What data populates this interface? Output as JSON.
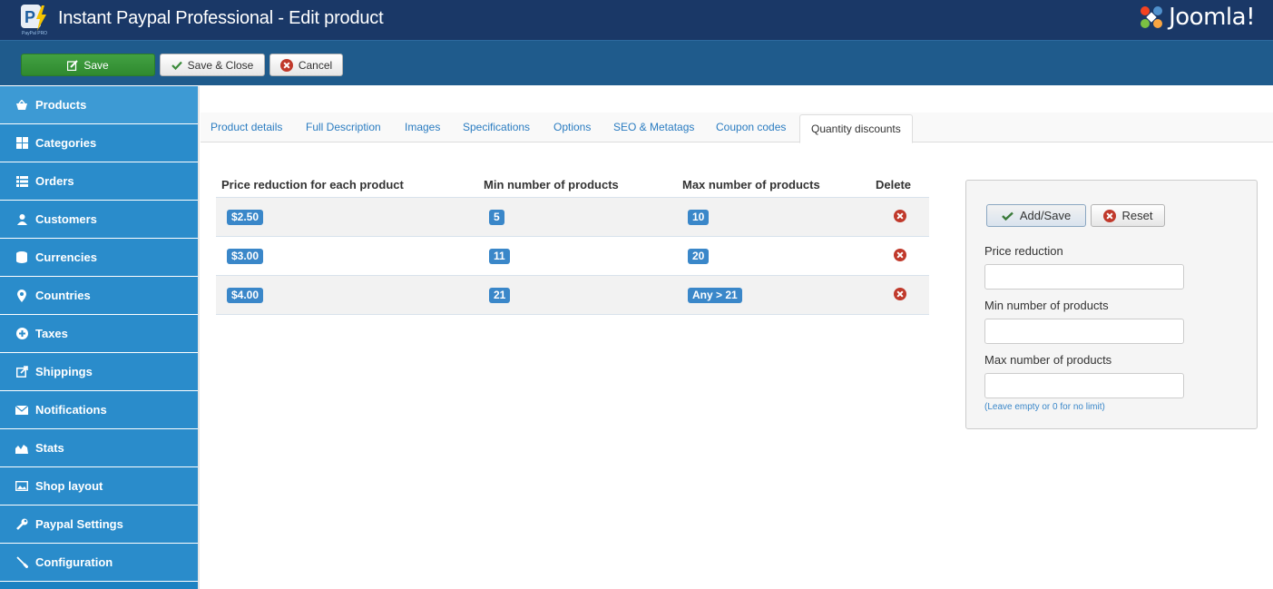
{
  "header": {
    "title": "Instant Paypal Professional - Edit product",
    "brand": "Joomla!",
    "app_logo_text": "PayPal PRO"
  },
  "toolbar": {
    "save_label": "Save",
    "save_close_label": "Save & Close",
    "cancel_label": "Cancel"
  },
  "sidebar": {
    "items": [
      {
        "label": "Products",
        "icon": "basket-icon"
      },
      {
        "label": "Categories",
        "icon": "grid-icon"
      },
      {
        "label": "Orders",
        "icon": "list-icon"
      },
      {
        "label": "Customers",
        "icon": "user-icon"
      },
      {
        "label": "Currencies",
        "icon": "database-icon"
      },
      {
        "label": "Countries",
        "icon": "location-pin-icon"
      },
      {
        "label": "Taxes",
        "icon": "plus-circle-icon"
      },
      {
        "label": "Shippings",
        "icon": "external-link-icon"
      },
      {
        "label": "Notifications",
        "icon": "envelope-icon"
      },
      {
        "label": "Stats",
        "icon": "chart-icon"
      },
      {
        "label": "Shop layout",
        "icon": "image-icon"
      },
      {
        "label": "Paypal Settings",
        "icon": "wrench-icon"
      },
      {
        "label": "Configuration",
        "icon": "screwdriver-icon"
      }
    ]
  },
  "tabs": [
    {
      "label": "Product details"
    },
    {
      "label": "Full Description"
    },
    {
      "label": "Images"
    },
    {
      "label": "Specifications"
    },
    {
      "label": "Options"
    },
    {
      "label": "SEO & Metatags"
    },
    {
      "label": "Coupon codes"
    },
    {
      "label": "Quantity discounts"
    }
  ],
  "discounts_table": {
    "headers": [
      "Price reduction for each product",
      "Min number of products",
      "Max number of products",
      "Delete"
    ],
    "rows": [
      {
        "price": "$2.50",
        "min": "5",
        "max": "10"
      },
      {
        "price": "$3.00",
        "min": "11",
        "max": "20"
      },
      {
        "price": "$4.00",
        "min": "21",
        "max": "Any > 21"
      }
    ]
  },
  "form": {
    "add_save_label": "Add/Save",
    "reset_label": "Reset",
    "price_reduction_label": "Price reduction",
    "min_label": "Min number of products",
    "max_label": "Max number of products",
    "max_hint": "(Leave empty or 0 for no limit)",
    "price_reduction_value": "",
    "min_value": "",
    "max_value": ""
  },
  "colors": {
    "header_bg": "#1a3867",
    "toolbar_bg": "#1f5b8c",
    "sidebar_bg": "#2a8ccb",
    "save_green": "#3a963a",
    "badge_blue": "#3a87c9",
    "delete_red": "#c0392b"
  }
}
